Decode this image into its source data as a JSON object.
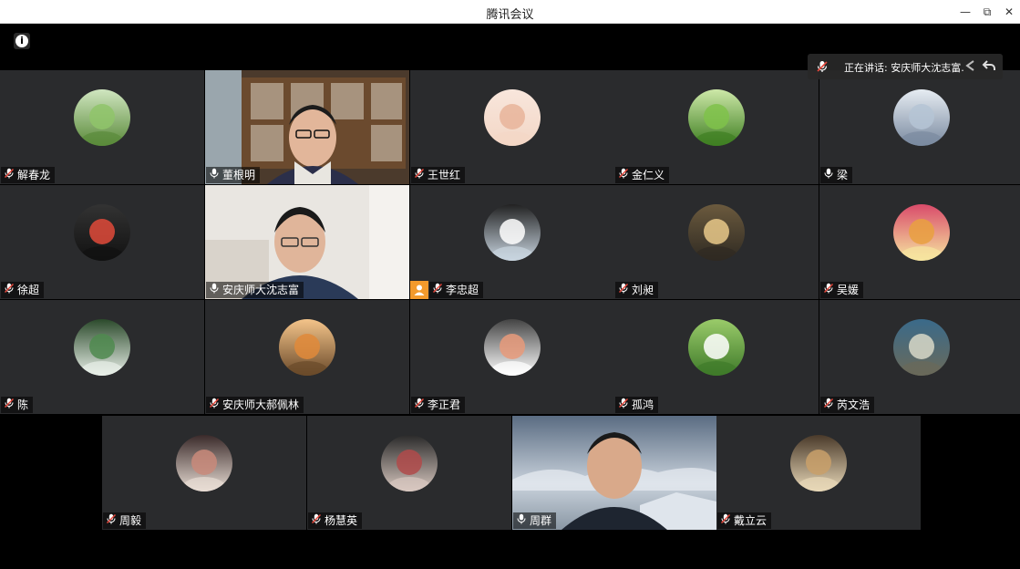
{
  "window": {
    "title": "腾讯会议",
    "controls": [
      "—",
      "⧉",
      "✕"
    ]
  },
  "info_glyph": "i",
  "speaking": {
    "text": "正在讲话: 安庆师大沈志富..."
  },
  "participants": [
    {
      "name": "解春龙",
      "muted": true,
      "type": "avatar",
      "avatar_colors": [
        "#5a8a3a",
        "#8fc46a",
        "#d0e6c0"
      ]
    },
    {
      "name": "董根明",
      "muted": false,
      "type": "video"
    },
    {
      "name": "王世红",
      "muted": true,
      "type": "avatar",
      "avatar_colors": [
        "#f3d7c6",
        "#e8b49a",
        "#f8e6dc"
      ]
    },
    {
      "name": "金仁义",
      "muted": true,
      "type": "avatar",
      "avatar_colors": [
        "#3f7f22",
        "#7fc24a",
        "#cde8a8"
      ]
    },
    {
      "name": "梁",
      "muted": false,
      "type": "avatar",
      "avatar_colors": [
        "#7a8aa0",
        "#b5c4d5",
        "#e6ecf2"
      ]
    },
    {
      "name": "徐超",
      "muted": true,
      "type": "avatar",
      "avatar_colors": [
        "#111111",
        "#e04a3a",
        "#333333"
      ]
    },
    {
      "name": "安庆师大沈志富",
      "muted": false,
      "type": "video",
      "active": true
    },
    {
      "name": "李忠超",
      "muted": true,
      "type": "avatar",
      "avatar_colors": [
        "#c9d5e0",
        "#ffffff",
        "#222222"
      ],
      "badge": "orange-user"
    },
    {
      "name": "刘昶",
      "muted": true,
      "type": "avatar",
      "avatar_colors": [
        "#2f2a22",
        "#e9c98a",
        "#6b5a3e"
      ]
    },
    {
      "name": "吴媛",
      "muted": true,
      "type": "avatar",
      "avatar_colors": [
        "#f6e6a0",
        "#e9a040",
        "#d94b6a"
      ]
    },
    {
      "name": "陈",
      "muted": true,
      "type": "avatar",
      "avatar_colors": [
        "#e8efe8",
        "#4f8a4f",
        "#2b4a2b"
      ]
    },
    {
      "name": "安庆师大郝佩林",
      "muted": true,
      "type": "avatar",
      "avatar_colors": [
        "#6a4a2a",
        "#e08a3a",
        "#f4c48a"
      ]
    },
    {
      "name": "李正君",
      "muted": true,
      "type": "avatar",
      "avatar_colors": [
        "#ffffff",
        "#e89a7a",
        "#444444"
      ]
    },
    {
      "name": "孤鸿",
      "muted": true,
      "type": "avatar",
      "avatar_colors": [
        "#3f7a2a",
        "#ffffff",
        "#9acb6a"
      ]
    },
    {
      "name": "芮文浩",
      "muted": true,
      "type": "avatar",
      "avatar_colors": [
        "#6a6a5a",
        "#d8d8c8",
        "#3a6a8a"
      ]
    },
    {
      "name": "周毅",
      "muted": true,
      "type": "avatar",
      "avatar_colors": [
        "#e8ddd4",
        "#c98a7a",
        "#3a2a2a"
      ]
    },
    {
      "name": "杨慧英",
      "muted": true,
      "type": "avatar",
      "avatar_colors": [
        "#d8c8c0",
        "#b04a4a",
        "#2a2a2a"
      ]
    },
    {
      "name": "周群",
      "muted": false,
      "type": "video"
    },
    {
      "name": "戴立云",
      "muted": true,
      "type": "avatar",
      "avatar_colors": [
        "#e8d8b8",
        "#c9a06a",
        "#4a3a2a"
      ]
    }
  ]
}
